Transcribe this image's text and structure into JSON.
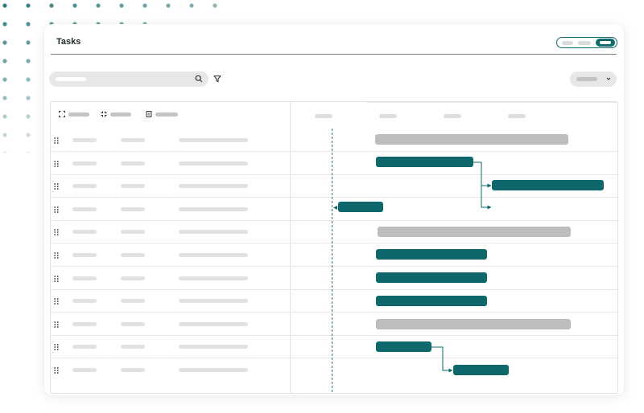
{
  "header": {
    "title": "Tasks"
  },
  "colors": {
    "accent": "#0e686b",
    "gray_bar": "#bdbdbd",
    "dot_grid": "#2f7c80"
  },
  "icons": {
    "search": "search-icon",
    "filter": "filter-icon",
    "dropdown": "chevron-down-icon",
    "col1": "expand-icon",
    "col2": "collapse-icon",
    "col3": "document-icon",
    "row_handle": "drag-handle-icon"
  },
  "gantt": {
    "tasks": [
      {
        "kind": "summary"
      },
      {
        "kind": "task"
      },
      {
        "kind": "task"
      },
      {
        "kind": "task"
      },
      {
        "kind": "summary"
      },
      {
        "kind": "task"
      },
      {
        "kind": "task"
      },
      {
        "kind": "task"
      },
      {
        "kind": "summary"
      },
      {
        "kind": "task"
      },
      {
        "kind": "task"
      }
    ]
  }
}
